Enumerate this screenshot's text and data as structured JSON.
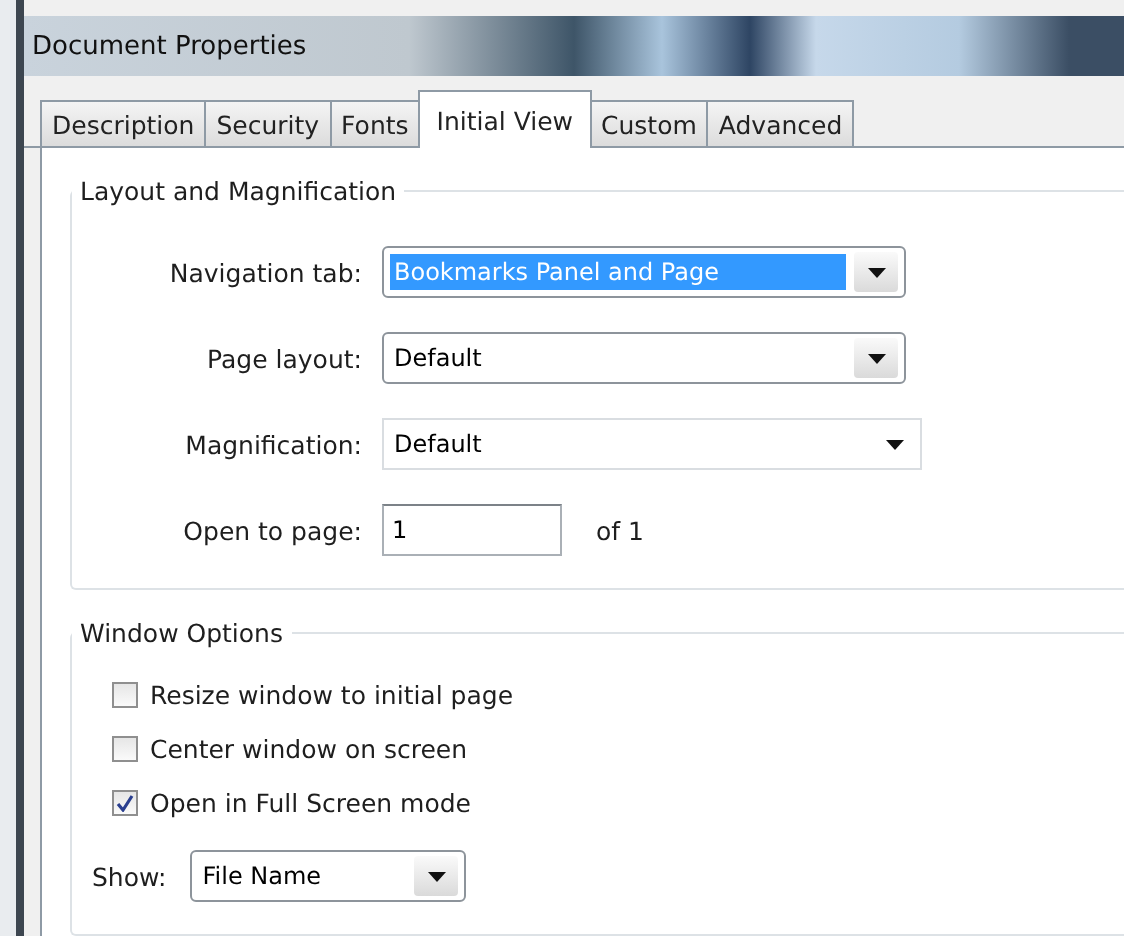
{
  "window": {
    "title": "Document Properties"
  },
  "tabs": [
    {
      "label": "Description",
      "selected": false
    },
    {
      "label": "Security",
      "selected": false
    },
    {
      "label": "Fonts",
      "selected": false
    },
    {
      "label": "Initial View",
      "selected": true
    },
    {
      "label": "Custom",
      "selected": false
    },
    {
      "label": "Advanced",
      "selected": false
    }
  ],
  "layout_and_magnification": {
    "title": "Layout and Magnification",
    "fields": [
      {
        "kind": "dropdown",
        "label": "Navigation tab:",
        "value": "Bookmarks Panel and Page",
        "focused": true
      },
      {
        "kind": "dropdown",
        "label": "Page layout:",
        "value": "Default",
        "focused": false
      },
      {
        "kind": "combo",
        "label": "Magnification:",
        "value": "Default",
        "focused": false
      },
      {
        "kind": "page",
        "label": "Open to page:",
        "value": "1",
        "suffix": "of 1",
        "focused": false
      }
    ]
  },
  "window_options": {
    "title": "Window Options",
    "checkboxes": [
      {
        "label": "Resize window to initial page",
        "checked": false
      },
      {
        "label": "Center window on screen",
        "checked": false
      },
      {
        "label": "Open in Full Screen mode",
        "checked": true
      }
    ],
    "show": {
      "label": "Show:",
      "value": "File Name"
    }
  }
}
